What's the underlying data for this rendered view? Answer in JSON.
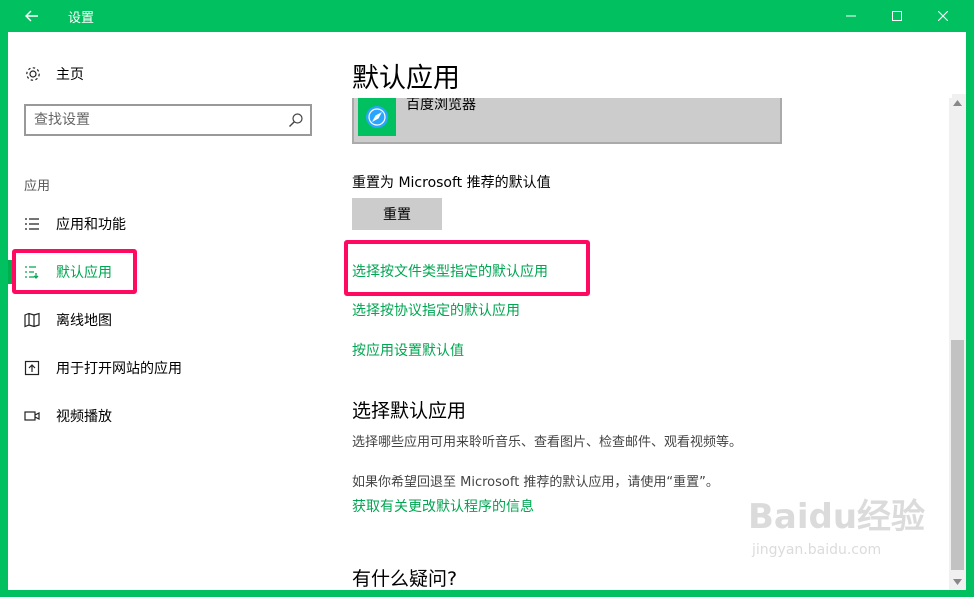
{
  "window": {
    "title": "设置",
    "accent": "#00C060"
  },
  "sidebar": {
    "home_label": "主页",
    "search_placeholder": "查找设置",
    "section": "应用",
    "items": [
      {
        "label": "应用和功能",
        "icon": "list-icon"
      },
      {
        "label": "默认应用",
        "icon": "default-apps-icon",
        "active": true
      },
      {
        "label": "离线地图",
        "icon": "map-icon"
      },
      {
        "label": "用于打开网站的应用",
        "icon": "open-web-icon"
      },
      {
        "label": "视频播放",
        "icon": "video-icon"
      }
    ]
  },
  "main": {
    "title": "默认应用",
    "browser_name": "百度浏览器",
    "reset_label": "重置为 Microsoft 推荐的默认值",
    "reset_button": "重置",
    "links": {
      "by_file_type": "选择按文件类型指定的默认应用",
      "by_protocol": "选择按协议指定的默认应用",
      "by_app": "按应用设置默认值"
    },
    "choose_heading": "选择默认应用",
    "choose_desc": "选择哪些应用可用来聆听音乐、查看图片、检查邮件、观看视频等。",
    "revert_desc": "如果你希望回退至 Microsoft 推荐的默认应用，请使用“重置”。",
    "info_link": "获取有关更改默认程序的信息",
    "faq_heading": "有什么疑问?"
  },
  "watermark": {
    "brand": "Baidu经验",
    "url": "jingyan.baidu.com"
  },
  "colors": {
    "link": "#00A651",
    "highlight": "#FF0A60"
  }
}
